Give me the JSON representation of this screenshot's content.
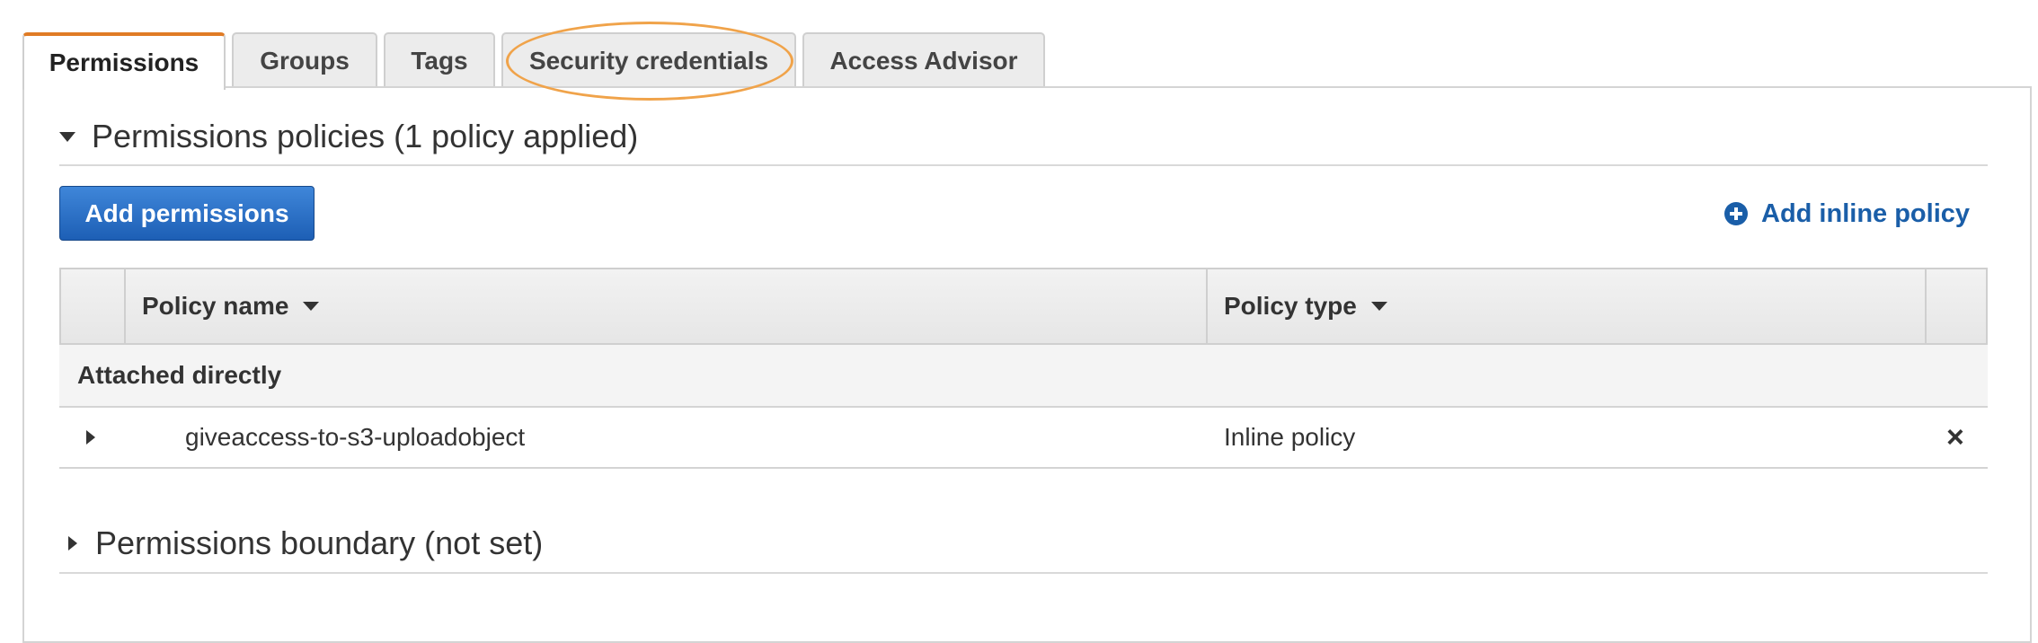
{
  "tabs": [
    {
      "label": "Permissions",
      "active": true
    },
    {
      "label": "Groups",
      "active": false
    },
    {
      "label": "Tags",
      "active": false
    },
    {
      "label": "Security credentials",
      "active": false,
      "highlighted": true
    },
    {
      "label": "Access Advisor",
      "active": false
    }
  ],
  "permissions_policies": {
    "title": "Permissions policies (1 policy applied)",
    "expanded": true,
    "add_permissions_label": "Add permissions",
    "add_inline_policy_label": "Add inline policy",
    "table": {
      "columns": [
        "Policy name",
        "Policy type"
      ],
      "groups": [
        {
          "label": "Attached directly",
          "rows": [
            {
              "policy_name": "giveaccess-to-s3-uploadobject",
              "policy_type": "Inline policy",
              "remove_icon": "×"
            }
          ]
        }
      ]
    }
  },
  "permissions_boundary": {
    "title": "Permissions boundary (not set)",
    "expanded": false
  },
  "colors": {
    "active_tab_accent": "#e07b25",
    "highlight_oval": "#f0a34a",
    "primary_button": "#1d5fb5",
    "link": "#1a5ea8"
  }
}
